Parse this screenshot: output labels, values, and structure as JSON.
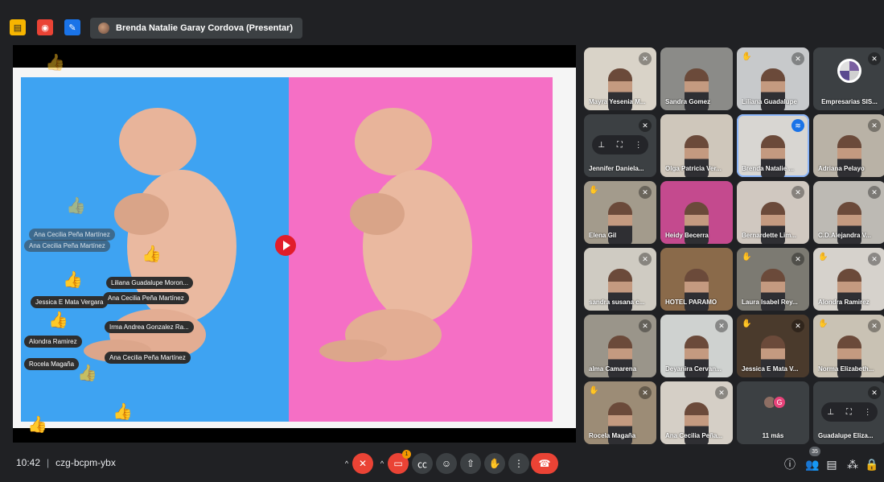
{
  "topbar": {
    "presenter_label": "Brenda Natalie Garay Cordova (Presentar)",
    "icons": [
      "slides-icon",
      "record-icon",
      "whiteboard-icon"
    ],
    "colors": {
      "slides": "#f7b500",
      "record": "#ea4335",
      "whiteboard": "#1a73e8"
    }
  },
  "stage": {
    "colors": {
      "blue_half": "#3ea3f2",
      "pink_half": "#f56fc5",
      "play": "#e11d2a"
    },
    "reaction_names": [
      "Ana Cecilia Peña Martínez",
      "Ana Cecilia Peña Martínez",
      "Liliana Guadalupe Moron...",
      "Jessica E Mata Vergara",
      "Ana Cecilia Peña Martínez",
      "Irma Andrea Gonzalez Ra...",
      "Alondra Ramirez",
      "Ana Cecilia Peña Martínez",
      "Rocela Magaña"
    ],
    "reaction_emoji": "👍"
  },
  "participants": [
    {
      "name": "Mayra Yesenia M...",
      "muted": true,
      "hand": false
    },
    {
      "name": "Sandra Gomez",
      "muted": false,
      "hand": false
    },
    {
      "name": "Liliana Guadalupe",
      "muted": true,
      "hand": true
    },
    {
      "name": "Empresarias SIS...",
      "muted": true,
      "hand": false
    },
    {
      "name": "Jennifer Daniela...",
      "muted": true,
      "hand": false
    },
    {
      "name": "Olga Patricia Ver...",
      "muted": false,
      "hand": false
    },
    {
      "name": "Brenda Natalie ...",
      "muted": false,
      "hand": false,
      "speaking": true
    },
    {
      "name": "Adriana Pelayo",
      "muted": true,
      "hand": false
    },
    {
      "name": "Elena Gil",
      "muted": true,
      "hand": true
    },
    {
      "name": "Heidy Becerra",
      "muted": false,
      "hand": false
    },
    {
      "name": "Bernardette Lim...",
      "muted": true,
      "hand": false
    },
    {
      "name": "C.D.Alejandra V...",
      "muted": true,
      "hand": false
    },
    {
      "name": "sandra susana c...",
      "muted": true,
      "hand": false
    },
    {
      "name": "HOTEL PARAMO",
      "muted": false,
      "hand": false
    },
    {
      "name": "Laura Isabel Rey...",
      "muted": true,
      "hand": true
    },
    {
      "name": "Alondra Ramirez",
      "muted": true,
      "hand": true
    },
    {
      "name": "alma Camarena",
      "muted": true,
      "hand": false
    },
    {
      "name": "Deyanira Cervan...",
      "muted": true,
      "hand": false
    },
    {
      "name": "Jessica E Mata V...",
      "muted": true,
      "hand": true
    },
    {
      "name": "Norma Elizabeth...",
      "muted": true,
      "hand": true
    },
    {
      "name": "Rocela Magaña",
      "muted": true,
      "hand": true
    },
    {
      "name": "Ana Cecilia Peña...",
      "muted": true,
      "hand": false
    },
    {
      "name": "11 más",
      "muted": false,
      "hand": false,
      "overflow": true
    },
    {
      "name": "Guadalupe Eliza...",
      "muted": true,
      "hand": false
    }
  ],
  "bottombar": {
    "time": "10:42",
    "meeting_code": "czg-bcpm-ybx",
    "present_badge": "1",
    "participant_count": "35",
    "overflow_avatar_letter": "G"
  }
}
